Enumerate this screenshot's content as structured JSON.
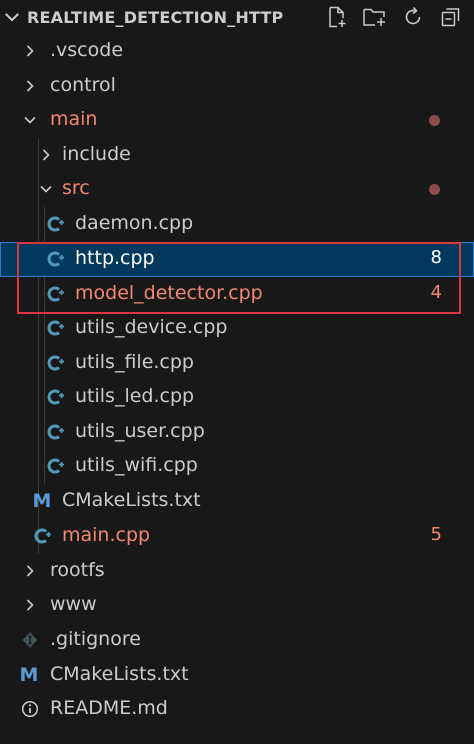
{
  "explorer": {
    "title": "REALTIME_DETECTION_HTTP",
    "toolbar": [
      "new-file",
      "new-folder",
      "refresh",
      "collapse-all"
    ]
  },
  "colors": {
    "background": "#181818",
    "text": "#cccccc",
    "error": "#f48771",
    "selected_bg": "#04395e",
    "cpp_icon": "#519aba",
    "cmake_icon": "#5b9bd5",
    "highlight_box": "#d9363e"
  },
  "tree": {
    "vscode": {
      "label": ".vscode"
    },
    "control": {
      "label": "control"
    },
    "main": {
      "label": "main"
    },
    "include": {
      "label": "include"
    },
    "src": {
      "label": "src"
    },
    "daemon": {
      "label": "daemon.cpp"
    },
    "http": {
      "label": "http.cpp",
      "badge": "8"
    },
    "model_detector": {
      "label": "model_detector.cpp",
      "badge": "4"
    },
    "utils_device": {
      "label": "utils_device.cpp"
    },
    "utils_file": {
      "label": "utils_file.cpp"
    },
    "utils_led": {
      "label": "utils_led.cpp"
    },
    "utils_user": {
      "label": "utils_user.cpp"
    },
    "utils_wifi": {
      "label": "utils_wifi.cpp"
    },
    "cmake_main": {
      "label": "CMakeLists.txt"
    },
    "main_cpp": {
      "label": "main.cpp",
      "badge": "5"
    },
    "rootfs": {
      "label": "rootfs"
    },
    "www": {
      "label": "www"
    },
    "gitignore": {
      "label": ".gitignore"
    },
    "cmake_root": {
      "label": "CMakeLists.txt"
    },
    "readme": {
      "label": "README.md"
    }
  }
}
